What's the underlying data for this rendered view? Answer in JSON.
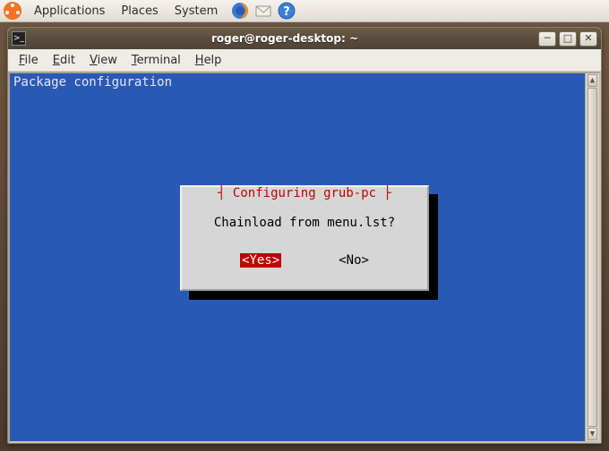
{
  "panel": {
    "menus": [
      "Applications",
      "Places",
      "System"
    ],
    "icons": [
      "firefox-icon",
      "evolution-icon",
      "help-icon"
    ]
  },
  "window": {
    "title": "roger@roger-desktop: ~",
    "menubar": [
      {
        "label": "File",
        "ul": "F",
        "rest": "ile"
      },
      {
        "label": "Edit",
        "ul": "E",
        "rest": "dit"
      },
      {
        "label": "View",
        "ul": "V",
        "rest": "iew"
      },
      {
        "label": "Terminal",
        "ul": "T",
        "rest": "erminal"
      },
      {
        "label": "Help",
        "ul": "H",
        "rest": "elp"
      }
    ],
    "controls": {
      "minimize": "─",
      "maximize": "□",
      "close": "✕"
    }
  },
  "terminal": {
    "header": "Package configuration"
  },
  "dialog": {
    "title_left": "┤ ",
    "title_text": "Configuring grub-pc",
    "title_right": " ├",
    "prompt": "Chainload from menu.lst?",
    "yes": "<Yes>",
    "no": "<No>"
  }
}
